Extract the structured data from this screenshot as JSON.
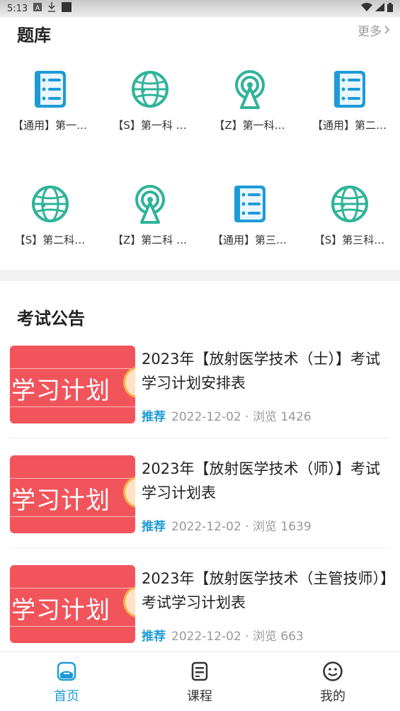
{
  "status_bar": {
    "time": "5:13"
  },
  "question_bank": {
    "title": "题库",
    "more_label": "更多",
    "items": [
      {
        "label": "【通用】第一…",
        "icon": "document-list-icon"
      },
      {
        "label": "【S】第一科 …",
        "icon": "globe-icon"
      },
      {
        "label": "【Z】第一科…",
        "icon": "radar-tower-icon"
      },
      {
        "label": "【通用】第二…",
        "icon": "document-list-icon"
      },
      {
        "label": "【S】第二科…",
        "icon": "globe-icon"
      },
      {
        "label": "【Z】第二科 …",
        "icon": "radar-tower-icon"
      },
      {
        "label": "【通用】第三…",
        "icon": "document-list-icon"
      },
      {
        "label": "【S】第三科…",
        "icon": "globe-icon"
      }
    ]
  },
  "notices": {
    "title": "考试公告",
    "items": [
      {
        "thumb_text": "学习计划",
        "title": "2023年【放射医学技术（士）】考试学习计划安排表",
        "tag": "推荐",
        "meta": "2022-12-02 · 浏览 1426"
      },
      {
        "thumb_text": "学习计划",
        "title": "2023年【放射医学技术（师）】考试学习计划表",
        "tag": "推荐",
        "meta": "2022-12-02 · 浏览 1639"
      },
      {
        "thumb_text": "学习计划",
        "title": "2023年【放射医学技术（主管技师）】考试学习计划表",
        "tag": "推荐",
        "meta": "2022-12-02 · 浏览 663"
      }
    ]
  },
  "tabbar": {
    "tabs": [
      {
        "label": "首页",
        "icon": "home-icon",
        "active": true
      },
      {
        "label": "课程",
        "icon": "course-icon",
        "active": false
      },
      {
        "label": "我的",
        "icon": "smiley-icon",
        "active": false
      }
    ]
  },
  "colors": {
    "accent": "#1e9bd7",
    "teal": "#2fb39a",
    "thumb_red": "#f2545b"
  }
}
